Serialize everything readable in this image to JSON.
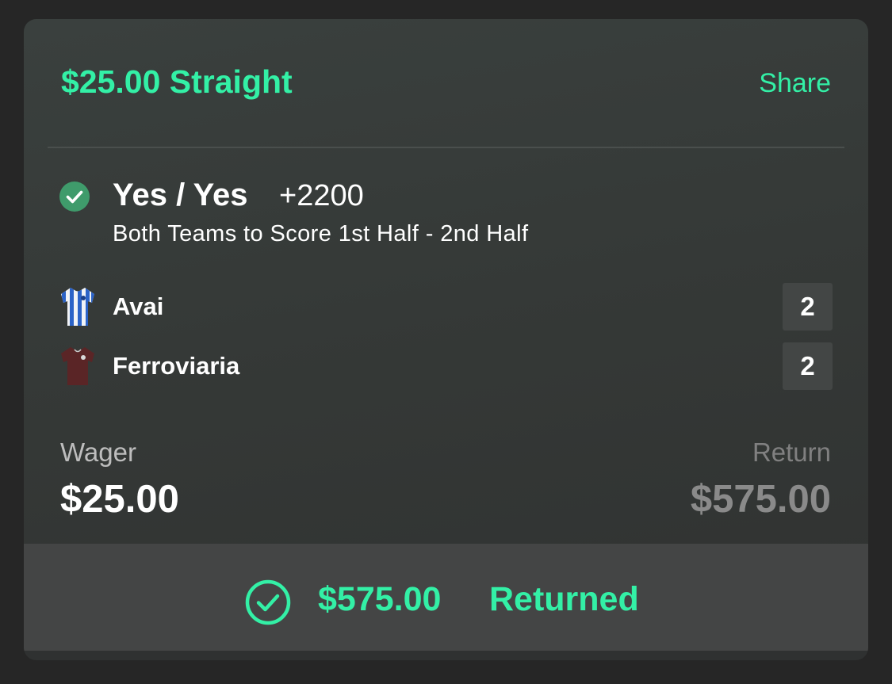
{
  "bet": {
    "title": "$25.00 Straight",
    "share_label": "Share",
    "selection": "Yes / Yes",
    "odds": "+2200",
    "market": "Both Teams to Score 1st Half - 2nd Half",
    "status_icon": "check-circle-icon"
  },
  "teams": [
    {
      "name": "Avai",
      "score": "2",
      "jersey_icon": "jersey-blue-white-stripes-icon"
    },
    {
      "name": "Ferroviaria",
      "score": "2",
      "jersey_icon": "jersey-maroon-icon"
    }
  ],
  "summary": {
    "wager_label": "Wager",
    "wager_value": "$25.00",
    "return_label": "Return",
    "return_value": "$575.00"
  },
  "result": {
    "amount": "$575.00",
    "status": "Returned",
    "icon": "check-circle-outline-icon"
  },
  "colors": {
    "accent": "#33f0a6",
    "win_badge": "#3f9b6b",
    "background": "#262626",
    "card": "#353937",
    "footer": "#444545"
  }
}
